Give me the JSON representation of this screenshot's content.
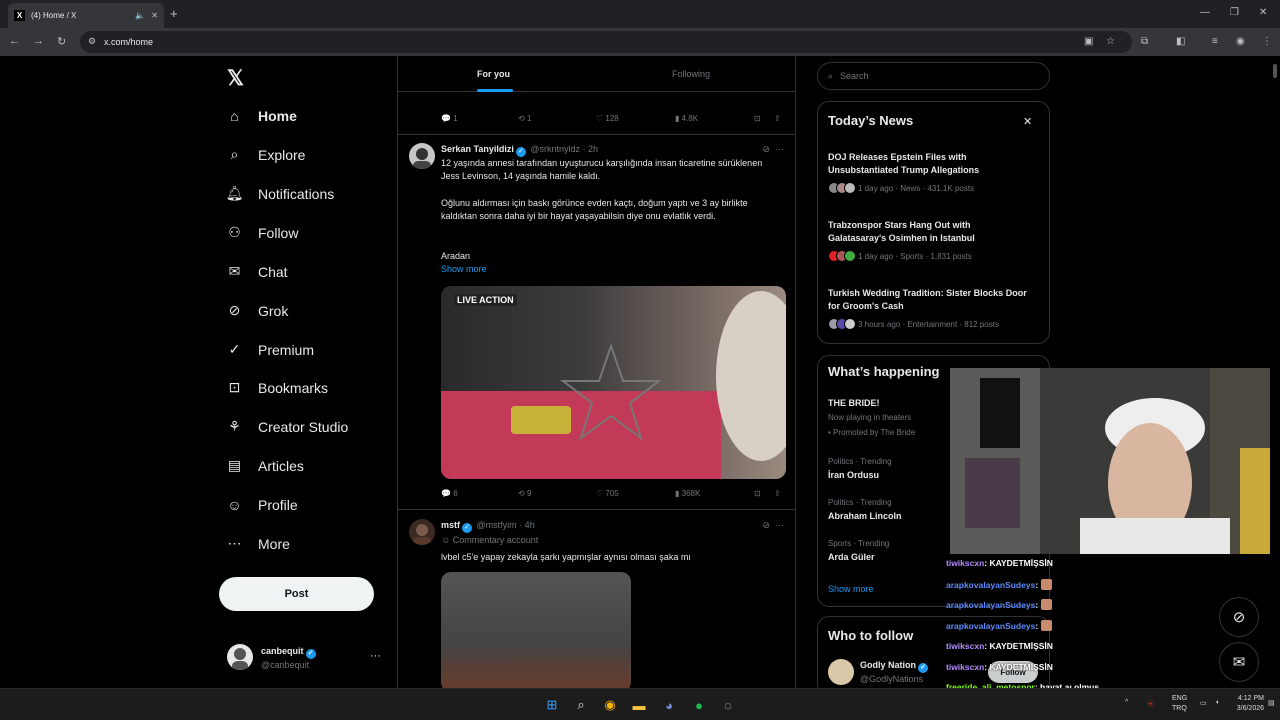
{
  "browser": {
    "tab_title": "(4) Home / X",
    "url": "x.com/home"
  },
  "nav": {
    "items": [
      {
        "label": "Home",
        "icon": "home-icon"
      },
      {
        "label": "Explore",
        "icon": "search-icon"
      },
      {
        "label": "Notifications",
        "icon": "bell-icon"
      },
      {
        "label": "Follow",
        "icon": "person-plus-icon"
      },
      {
        "label": "Chat",
        "icon": "mail-icon"
      },
      {
        "label": "Grok",
        "icon": "grok-icon"
      },
      {
        "label": "Premium",
        "icon": "verified-icon"
      },
      {
        "label": "Bookmarks",
        "icon": "bookmark-icon"
      },
      {
        "label": "Creator Studio",
        "icon": "creator-icon"
      },
      {
        "label": "Articles",
        "icon": "article-icon"
      },
      {
        "label": "Profile",
        "icon": "person-icon"
      },
      {
        "label": "More",
        "icon": "more-circle-icon"
      }
    ],
    "post_label": "Post",
    "account": {
      "name": "canbequit",
      "handle": "@canbequit"
    }
  },
  "timeline": {
    "tabs": [
      "For you",
      "Following"
    ],
    "top_actions": {
      "replies": "1",
      "reposts": "1",
      "likes": "128",
      "views": "4.8K"
    },
    "posts": [
      {
        "name": "Serkan Tanyildizi",
        "handle": "@srkntnyldz",
        "time": "· 2h",
        "p1": "12 yaşında annesi tarafından uyuşturucu karşılığında insan ticaretine sürüklenen Jess Levinson, 14 yaşında hamile kaldı.",
        "p2": "Oğlunu aldırması için baskı görünce evden kaçtı, doğum yaptı ve 3 ay birlikte kaldıktan sonra daha iyi bir hayat yaşayabilsin diye onu evlatlık verdi.",
        "p3": "Aradan",
        "show_more": "Show more",
        "media_watermark": "LIVE ACTION",
        "replies": "6",
        "reposts": "9",
        "likes": "705",
        "views": "368K"
      },
      {
        "name": "mstf",
        "handle": "@mstfyim",
        "time": "· 4h",
        "label": "Commentary account",
        "text": "lvbel c5'e yapay zekayla şarkı yapmışlar aynısı olması şaka mı"
      }
    ]
  },
  "sidebar": {
    "search_placeholder": "Search",
    "news": {
      "title": "Today’s News",
      "items": [
        {
          "title": "DOJ Releases Epstein Files with Unsubstantiated Trump Allegations",
          "meta": "1 day ago · News · 431.1K posts"
        },
        {
          "title": "Trabzonspor Stars Hang Out with Galatasaray's Osimhen in Istanbul",
          "meta": "1 day ago · Sports · 1,831 posts"
        },
        {
          "title": "Turkish Wedding Tradition: Sister Blocks Door for Groom's Cash",
          "meta": "3 hours ago · Entertainment · 812 posts"
        }
      ]
    },
    "happening": {
      "title": "What’s happening",
      "promo_title": "THE BRIDE!",
      "promo_sub": "Now playing in theaters",
      "promo_by": "Promoted by The Bride",
      "trends": [
        {
          "context": "Politics · Trending",
          "name": "İran Ordusu"
        },
        {
          "context": "Politics · Trending",
          "name": "Abraham Lincoln"
        },
        {
          "context": "Sports · Trending",
          "name": "Arda Güler"
        }
      ],
      "show_more": "Show more"
    },
    "who": {
      "title": "Who to follow",
      "name": "Godly Nation",
      "handle": "@GodlyNations",
      "follow": "Follow"
    }
  },
  "chat": [
    {
      "user": "tiwikscxn",
      "msg": ": KAYDETMİŞSİN",
      "color": "#b38cff",
      "emote": false
    },
    {
      "user": "arapkovalayanSudeys",
      "msg": ": ",
      "color": "#5b8cff",
      "emote": true
    },
    {
      "user": "arapkovalayanSudeys",
      "msg": ": ",
      "color": "#5b8cff",
      "emote": true
    },
    {
      "user": "arapkovalayanSudeys",
      "msg": ": ",
      "color": "#5b8cff",
      "emote": true
    },
    {
      "user": "tiwikscxn",
      "msg": ": KAYDETMİŞSİN",
      "color": "#b38cff",
      "emote": false
    },
    {
      "user": "tiwikscxn",
      "msg": ": KAYDETMİŞSİN",
      "color": "#b38cff",
      "emote": false
    },
    {
      "user": "freeride_ali_metospor",
      "msg": ": hayat aı olmuş",
      "color": "#7cfc00",
      "emote": false
    },
    {
      "user": "tiwikscxn",
      "msg": ": KAYDETMİŞSİN",
      "color": "#b38cff",
      "emote": false
    }
  ],
  "tray": {
    "lang1": "ENG",
    "lang2": "TRQ",
    "time": "4:12 PM",
    "date": "3/6/2026"
  },
  "colors": {
    "accent": "#1d9bf0",
    "bg": "#000000",
    "border": "#2f3336",
    "muted": "#71767b"
  }
}
